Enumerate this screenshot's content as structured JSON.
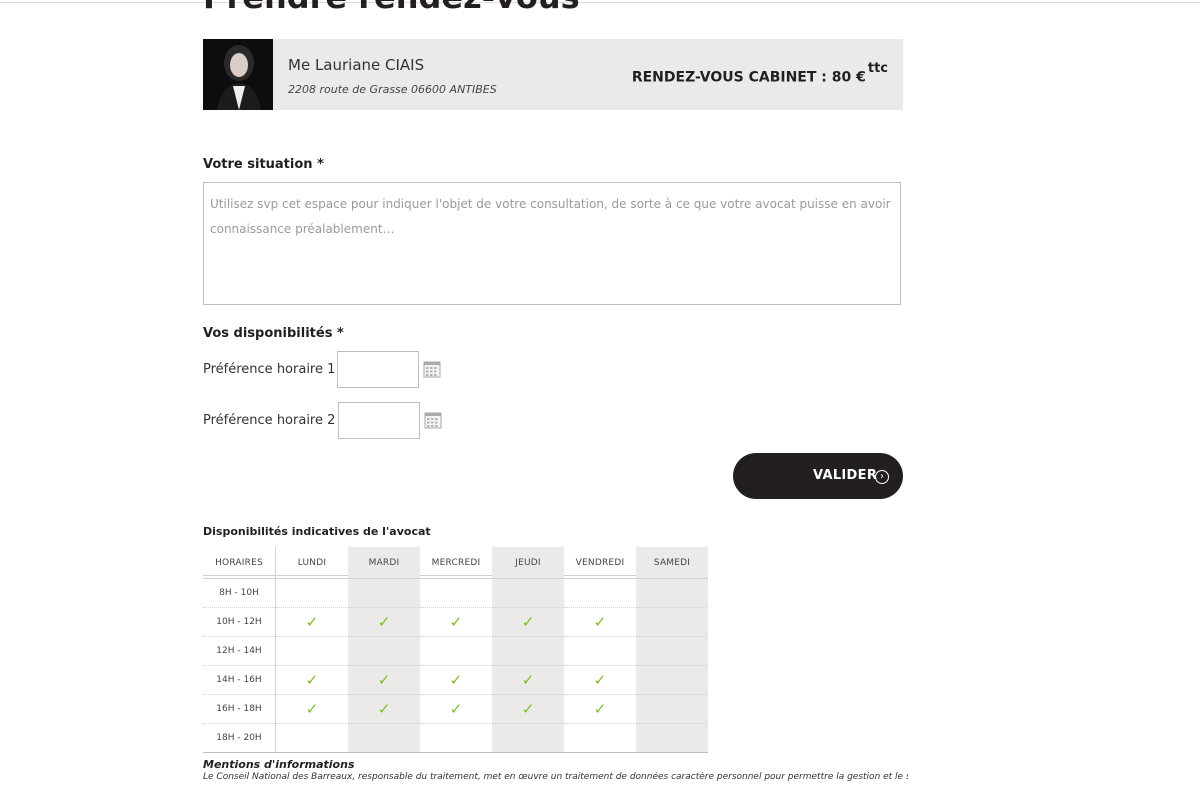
{
  "page": {
    "title": "Prendre rendez-vous"
  },
  "lawyer": {
    "name": "Me Lauriane CIAIS",
    "address": "2208 route de Grasse 06600 ANTIBES",
    "price_label": "RENDEZ-VOUS CABINET : 80 €",
    "price_suffix": "ttc"
  },
  "situation": {
    "label": "Votre situation *",
    "placeholder": "Utilisez svp cet espace pour indiquer l'objet de votre consultation, de sorte à ce que votre avocat puisse en avoir connaissance préalablement…",
    "value": ""
  },
  "availability_form": {
    "label": "Vos disponibilités *",
    "pref1_label": "Préférence horaire 1 :",
    "pref2_label": "Préférence horaire 2 :",
    "pref1_value": "",
    "pref2_value": ""
  },
  "submit": {
    "label": "VALIDER",
    "icon": "chevron-circle-right-icon"
  },
  "schedule": {
    "title": "Disponibilités indicatives de l'avocat",
    "columns": [
      "HORAIRES",
      "LUNDI",
      "MARDI",
      "MERCREDI",
      "JEUDI",
      "VENDREDI",
      "SAMEDI"
    ],
    "rows": [
      {
        "slot": "8H - 10H",
        "available": [
          false,
          false,
          false,
          false,
          false,
          false
        ]
      },
      {
        "slot": "10H - 12H",
        "available": [
          true,
          true,
          true,
          true,
          true,
          false
        ]
      },
      {
        "slot": "12H - 14H",
        "available": [
          false,
          false,
          false,
          false,
          false,
          false
        ]
      },
      {
        "slot": "14H - 16H",
        "available": [
          true,
          true,
          true,
          true,
          true,
          false
        ]
      },
      {
        "slot": "16H - 18H",
        "available": [
          true,
          true,
          true,
          true,
          true,
          false
        ]
      },
      {
        "slot": "18H - 20H",
        "available": [
          false,
          false,
          false,
          false,
          false,
          false
        ]
      }
    ],
    "check_glyph": "✓",
    "check_color": "#7ac21d"
  },
  "mentions": {
    "title": "Mentions d'informations",
    "text": "Le Conseil National des Barreaux, responsable du traitement, met en œuvre un traitement de données caractère personnel pour permettre la gestion et le suivi des"
  }
}
